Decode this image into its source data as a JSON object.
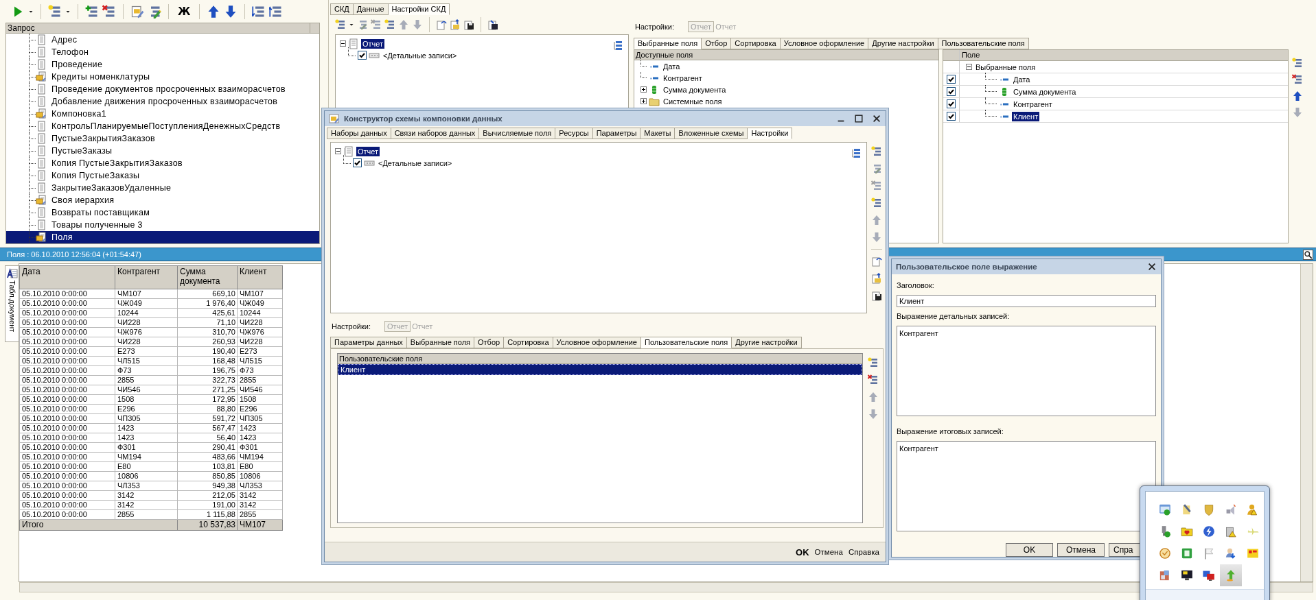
{
  "toolbar": {
    "bold_button": "Ж"
  },
  "query_panel": {
    "header": "Запрос",
    "items": [
      {
        "label": "Адрес",
        "kind": "query",
        "selected": false
      },
      {
        "label": "Телофон",
        "kind": "query",
        "selected": false
      },
      {
        "label": "Проведение",
        "kind": "query",
        "selected": false
      },
      {
        "label": "Кредиты номенклатуры",
        "kind": "composition",
        "selected": false
      },
      {
        "label": "Проведение документов просроченных взаиморасчетов",
        "kind": "query",
        "selected": false
      },
      {
        "label": "Добавление движения просроченных взаиморасчетов",
        "kind": "query",
        "selected": false
      },
      {
        "label": "Компоновка1",
        "kind": "composition",
        "selected": false
      },
      {
        "label": "КонтрольПланируемыеПоступленияДенежныхСредств",
        "kind": "query",
        "selected": false
      },
      {
        "label": "ПустыеЗакрытияЗаказов",
        "kind": "query",
        "selected": false
      },
      {
        "label": "ПустыеЗаказы",
        "kind": "query",
        "selected": false
      },
      {
        "label": "Копия ПустыеЗакрытияЗаказов",
        "kind": "query",
        "selected": false
      },
      {
        "label": "Копия ПустыеЗаказы",
        "kind": "query",
        "selected": false
      },
      {
        "label": "ЗакрытиеЗаказовУдаленные",
        "kind": "query",
        "selected": false
      },
      {
        "label": "Своя иерархия",
        "kind": "composition",
        "selected": false
      },
      {
        "label": "Возвраты поставщикам",
        "kind": "query",
        "selected": false
      },
      {
        "label": "Товары полученные 3",
        "kind": "query",
        "selected": false
      },
      {
        "label": "Поля",
        "kind": "composition",
        "selected": true
      }
    ]
  },
  "skd_tabs": [
    {
      "label": "СКД",
      "selected": false
    },
    {
      "label": "Данные",
      "selected": false
    },
    {
      "label": "Настройки СКД",
      "selected": true
    }
  ],
  "structure_tree": {
    "root": {
      "label": "Отчет",
      "expanded": true,
      "selected": true
    },
    "children": [
      {
        "label": "<Детальные записи>",
        "checked": true
      }
    ]
  },
  "settings_bar": {
    "label": "Настройки:",
    "button": "Отчет",
    "value": "Отчет"
  },
  "settings_tabs": [
    {
      "label": "Выбранные поля",
      "selected": true
    },
    {
      "label": "Отбор",
      "selected": false
    },
    {
      "label": "Сортировка",
      "selected": false
    },
    {
      "label": "Условное оформление",
      "selected": false
    },
    {
      "label": "Другие настройки",
      "selected": false
    },
    {
      "label": "Пользовательские поля",
      "selected": false
    }
  ],
  "available_fields": {
    "header": "Доступные поля",
    "items": [
      {
        "label": "Дата",
        "kind": "field",
        "expandable": false
      },
      {
        "label": "Контрагент",
        "kind": "field",
        "expandable": false
      },
      {
        "label": "Сумма документа",
        "kind": "resource",
        "expandable": true
      },
      {
        "label": "Системные поля",
        "kind": "folder",
        "expandable": true
      }
    ]
  },
  "selected_fields": {
    "header": "Поле",
    "group": {
      "label": "Выбранные поля",
      "expanded": true
    },
    "items": [
      {
        "label": "Дата",
        "kind": "field",
        "checked": true,
        "selected": false
      },
      {
        "label": "Сумма документа",
        "kind": "resource",
        "checked": true,
        "selected": false
      },
      {
        "label": "Контрагент",
        "kind": "field",
        "checked": true,
        "selected": false
      },
      {
        "label": "Клиент",
        "kind": "field",
        "checked": true,
        "selected": true
      }
    ]
  },
  "status_bar": {
    "text": "Поля : 06.10.2010 12:56:04 (+01:54:47)"
  },
  "side_tab": "Табл.документ",
  "report_table": {
    "columns": [
      "Дата",
      "Контрагент",
      "Сумма документа",
      "Клиент"
    ],
    "rows": [
      [
        "05.10.2010 0:00:00",
        "ЧМ107",
        "669,10",
        "ЧМ107"
      ],
      [
        "05.10.2010 0:00:00",
        "ЧЖ049",
        "1 976,40",
        "ЧЖ049"
      ],
      [
        "05.10.2010 0:00:00",
        "10244",
        "425,61",
        "10244"
      ],
      [
        "05.10.2010 0:00:00",
        "ЧИ228",
        "71,10",
        "ЧИ228"
      ],
      [
        "05.10.2010 0:00:00",
        "ЧЖ976",
        "310,70",
        "ЧЖ976"
      ],
      [
        "05.10.2010 0:00:00",
        "ЧИ228",
        "260,93",
        "ЧИ228"
      ],
      [
        "05.10.2010 0:00:00",
        "Е273",
        "190,40",
        "Е273"
      ],
      [
        "05.10.2010 0:00:00",
        "ЧЛ515",
        "168,48",
        "ЧЛ515"
      ],
      [
        "05.10.2010 0:00:00",
        "Ф73",
        "196,75",
        "Ф73"
      ],
      [
        "05.10.2010 0:00:00",
        "2855",
        "322,73",
        "2855"
      ],
      [
        "05.10.2010 0:00:00",
        "ЧИ546",
        "271,25",
        "ЧИ546"
      ],
      [
        "05.10.2010 0:00:00",
        "1508",
        "172,95",
        "1508"
      ],
      [
        "05.10.2010 0:00:00",
        "Е296",
        "88,80",
        "Е296"
      ],
      [
        "05.10.2010 0:00:00",
        "ЧП305",
        "591,72",
        "ЧП305"
      ],
      [
        "05.10.2010 0:00:00",
        "1423",
        "567,47",
        "1423"
      ],
      [
        "05.10.2010 0:00:00",
        "1423",
        "56,40",
        "1423"
      ],
      [
        "05.10.2010 0:00:00",
        "Ф301",
        "290,41",
        "Ф301"
      ],
      [
        "05.10.2010 0:00:00",
        "ЧМ194",
        "483,66",
        "ЧМ194"
      ],
      [
        "05.10.2010 0:00:00",
        "Е80",
        "103,81",
        "Е80"
      ],
      [
        "05.10.2010 0:00:00",
        "10806",
        "850,85",
        "10806"
      ],
      [
        "05.10.2010 0:00:00",
        "ЧЛ353",
        "949,38",
        "ЧЛ353"
      ],
      [
        "05.10.2010 0:00:00",
        "3142",
        "212,05",
        "3142"
      ],
      [
        "05.10.2010 0:00:00",
        "3142",
        "191,00",
        "3142"
      ],
      [
        "05.10.2010 0:00:00",
        "2855",
        "1 115,88",
        "2855"
      ]
    ],
    "total": {
      "label": "Итого",
      "sum": "10 537,83",
      "client": "ЧМ107"
    }
  },
  "constructor_dialog": {
    "title": "Конструктор схемы компоновки данных",
    "tabs": [
      {
        "label": "Наборы данных",
        "selected": false
      },
      {
        "label": "Связи наборов данных",
        "selected": false
      },
      {
        "label": "Вычисляемые поля",
        "selected": false
      },
      {
        "label": "Ресурсы",
        "selected": false
      },
      {
        "label": "Параметры",
        "selected": false
      },
      {
        "label": "Макеты",
        "selected": false
      },
      {
        "label": "Вложенные схемы",
        "selected": false
      },
      {
        "label": "Настройки",
        "selected": true
      }
    ],
    "tree": {
      "root": {
        "label": "Отчет",
        "expanded": true,
        "selected": true
      },
      "children": [
        {
          "label": "<Детальные записи>",
          "checked": true
        }
      ]
    },
    "settings_bar": {
      "label": "Настройки:",
      "button": "Отчет",
      "value": "Отчет"
    },
    "lower_tabs": [
      {
        "label": "Параметры данных",
        "selected": false
      },
      {
        "label": "Выбранные поля",
        "selected": false
      },
      {
        "label": "Отбор",
        "selected": false
      },
      {
        "label": "Сортировка",
        "selected": false
      },
      {
        "label": "Условное оформление",
        "selected": false
      },
      {
        "label": "Пользовательские поля",
        "selected": true
      },
      {
        "label": "Другие настройки",
        "selected": false
      }
    ],
    "custom_fields": {
      "header": "Пользовательские поля",
      "items": [
        {
          "label": "Клиент",
          "selected": true
        }
      ]
    },
    "buttons": [
      {
        "label": "OK",
        "kind": "default"
      },
      {
        "label": "Отмена",
        "kind": "normal"
      },
      {
        "label": "Справка",
        "kind": "normal"
      }
    ]
  },
  "expression_dialog": {
    "title": "Пользовательское поле выражение",
    "caption_label": "Заголовок:",
    "caption_value": "Клиент",
    "detail_label": "Выражение детальных записей:",
    "detail_value": "Контрагент",
    "total_label": "Выражение итоговых записей:",
    "total_value": "Контрагент",
    "buttons": [
      "OK",
      "Отмена",
      "Спра"
    ]
  },
  "tray_icons": [
    {
      "kind": "update",
      "selected": false
    },
    {
      "kind": "tools",
      "selected": false
    },
    {
      "kind": "shield",
      "selected": false
    },
    {
      "kind": "speaker",
      "selected": false
    },
    {
      "kind": "user",
      "selected": false
    },
    {
      "kind": "plug",
      "selected": false
    },
    {
      "kind": "folder",
      "selected": false
    },
    {
      "kind": "lightning",
      "selected": false
    },
    {
      "kind": "network",
      "selected": false
    },
    {
      "kind": "plane",
      "selected": false
    },
    {
      "kind": "clock",
      "selected": false
    },
    {
      "kind": "square",
      "selected": false
    },
    {
      "kind": "flag",
      "selected": false
    },
    {
      "kind": "person",
      "selected": false
    },
    {
      "kind": "badge",
      "selected": false
    },
    {
      "kind": "package",
      "selected": false
    },
    {
      "kind": "monitor",
      "selected": false
    },
    {
      "kind": "screens",
      "selected": false
    },
    {
      "kind": "arrow",
      "selected": true
    }
  ]
}
